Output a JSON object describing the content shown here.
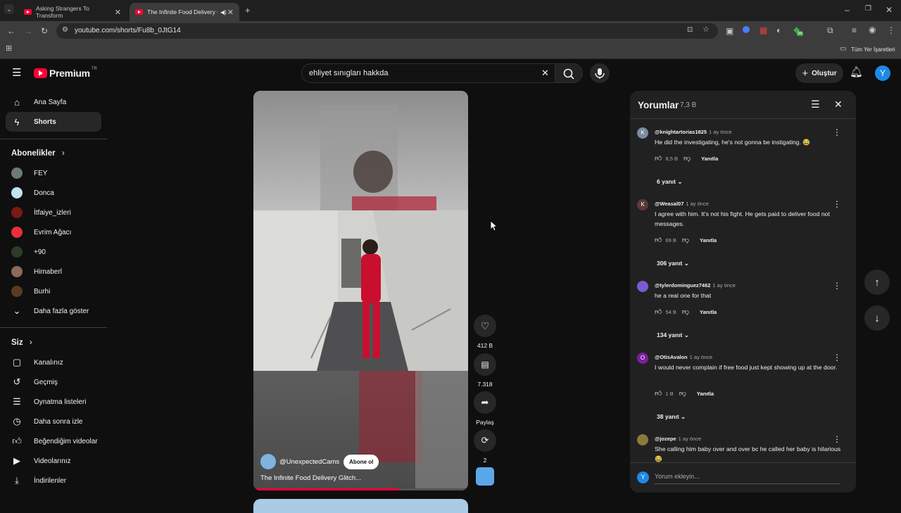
{
  "browser": {
    "tabs": [
      {
        "title": "Asking Strangers To Transform",
        "active": false
      },
      {
        "title": "The Infinite Food Delivery G",
        "active": true
      }
    ],
    "url": "youtube.com/shorts/Fu8b_0JtG14",
    "bookmarks_label": "Tüm Yer İşaretleri",
    "extension_badge": "36"
  },
  "header": {
    "logo_text": "Premium",
    "logo_region": "TR",
    "search_value": "ehliyet sınıgları hakkda",
    "create_label": "Oluştur",
    "avatar_letter": "Y"
  },
  "sidebar": {
    "main": [
      {
        "label": "Ana Sayfa",
        "icon": "home-icon"
      },
      {
        "label": "Shorts",
        "icon": "shorts-icon"
      }
    ],
    "subscriptions_title": "Abonelikler",
    "subscriptions": [
      {
        "label": "FEY",
        "color": "#6f7a74"
      },
      {
        "label": "Donca",
        "color": "#bfe3f0"
      },
      {
        "label": "İtfaiye_izleri",
        "color": "#7a1a14"
      },
      {
        "label": "Evrim Ağacı",
        "color": "#e8303a"
      },
      {
        "label": "+90",
        "color": "#2f3b2a"
      },
      {
        "label": "Himaberl",
        "color": "#8a6a5a"
      },
      {
        "label": "Burhi",
        "color": "#5a3a22"
      }
    ],
    "show_more": "Daha fazla göster",
    "you_title": "Siz",
    "you_items": [
      {
        "label": "Kanalınız",
        "icon": "channel-icon"
      },
      {
        "label": "Geçmiş",
        "icon": "history-icon"
      },
      {
        "label": "Oynatma listeleri",
        "icon": "playlist-icon"
      },
      {
        "label": "Daha sonra izle",
        "icon": "clock-icon"
      },
      {
        "label": "Beğendiğim videolar",
        "icon": "thumbs-up-icon"
      },
      {
        "label": "Videolarınız",
        "icon": "video-icon"
      },
      {
        "label": "İndirilenler",
        "icon": "download-icon"
      }
    ]
  },
  "short": {
    "channel": "@UnexpectedCams",
    "subscribe_label": "Abone ol",
    "title": "The Infinite Food Delivery Glitch...",
    "likes": "412 B",
    "comments": "7.318",
    "share": "Paylaş",
    "remix": "2",
    "progress": 0.68
  },
  "comments_panel": {
    "title": "Yorumlar",
    "count": "7,3 B",
    "reply_label": "Yanıtla",
    "add_placeholder": "Yorum ekleyin...",
    "items": [
      {
        "author": "@knightartorias1825",
        "time": "1 ay önce",
        "text": "He did the investigating, he's not gonna be instigating. 😂",
        "likes": "8,5 B",
        "replies": "6 yanıt",
        "avatar": "K",
        "color": "#7a8aa0"
      },
      {
        "author": "@Weasal07",
        "time": "1 ay önce",
        "text": "I agree with him. It's not his fight. He gets paid to deliver food not messages.",
        "likes": "69 B",
        "replies": "306 yanıt",
        "avatar": "K",
        "color": "#5b3a3a"
      },
      {
        "author": "@tylerdominguez7462",
        "time": "1 ay önce",
        "text": "he a real one for that",
        "likes": "54 B",
        "replies": "134 yanıt",
        "avatar": "",
        "color": "#7a5bd0"
      },
      {
        "author": "@OtisAvalon",
        "time": "1 ay önce",
        "text": "I would never complain if free food just kept showing up at the door.",
        "likes": "1 B",
        "replies": "38 yanıt",
        "avatar": "O",
        "color": "#7b1fa2"
      },
      {
        "author": "@jozepe",
        "time": "1 ay önce",
        "text": "She calling him baby over and over bc he called her baby is hilarious 😂",
        "likes": "",
        "replies": "",
        "avatar": "",
        "color": "#8a7a3a"
      }
    ]
  }
}
